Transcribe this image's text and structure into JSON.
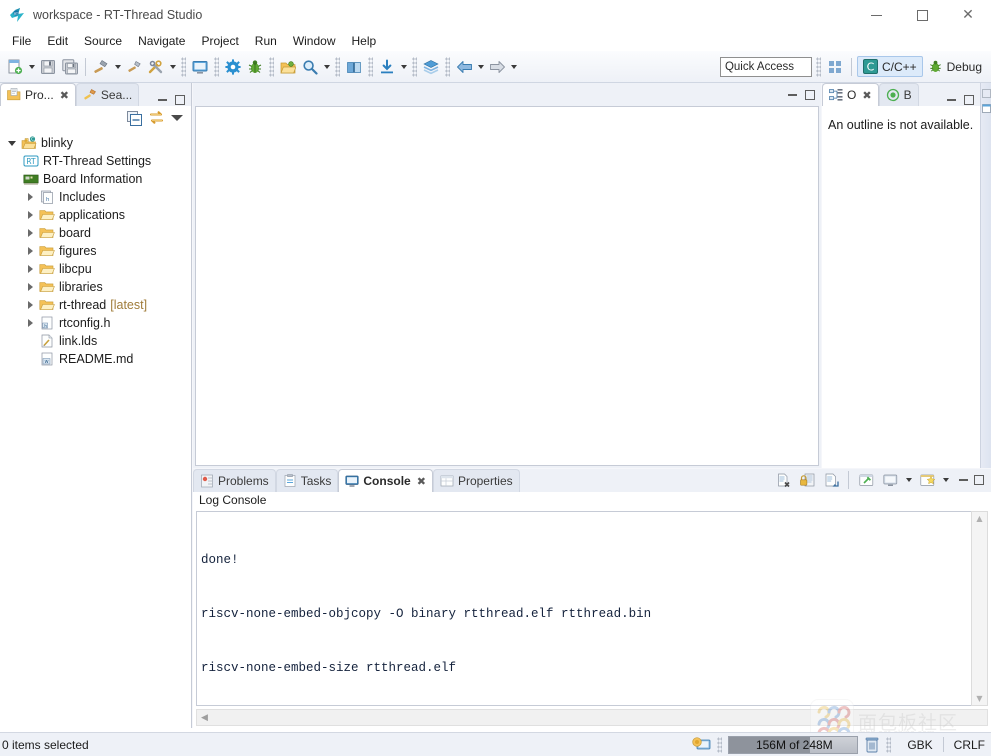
{
  "window": {
    "title": "workspace - RT-Thread Studio",
    "app_icon": "rt-thread-logo-icon",
    "controls": {
      "minimize": "minimize-icon",
      "maximize": "maximize-icon",
      "close": "close-icon"
    }
  },
  "menubar": {
    "items": [
      {
        "label": "File"
      },
      {
        "label": "Edit"
      },
      {
        "label": "Source"
      },
      {
        "label": "Navigate"
      },
      {
        "label": "Project"
      },
      {
        "label": "Run"
      },
      {
        "label": "Window"
      },
      {
        "label": "Help"
      }
    ]
  },
  "toolbar": {
    "items": [
      {
        "icon": "new-file-icon",
        "dropdown": true
      },
      {
        "icon": "save-icon",
        "dropdown": false
      },
      {
        "icon": "save-all-icon",
        "dropdown": false
      },
      {
        "icon": "build-hammer-icon",
        "dropdown": true
      },
      {
        "icon": "clean-icon",
        "dropdown": false
      },
      {
        "icon": "build-tools-icon",
        "dropdown": true
      },
      {
        "icon": "terminal-icon",
        "dropdown": false
      },
      {
        "icon": "settings-gear-icon",
        "dropdown": false
      },
      {
        "icon": "debug-bug-icon",
        "dropdown": false
      },
      {
        "icon": "open-package-icon",
        "dropdown": false
      },
      {
        "icon": "search-icon",
        "dropdown": true
      },
      {
        "icon": "book-icon",
        "dropdown": false
      },
      {
        "icon": "download-icon",
        "dropdown": true
      },
      {
        "icon": "layers-icon",
        "dropdown": false
      },
      {
        "icon": "back-arrow-icon",
        "dropdown": true
      },
      {
        "icon": "forward-arrow-icon",
        "dropdown": true
      }
    ],
    "quick_access": "Quick Access",
    "perspectives": {
      "open_perspective_icon": "grid-perspective-icon",
      "items": [
        {
          "label": "C/C++",
          "icon": "cpp-perspective-icon",
          "active": true
        },
        {
          "label": "Debug",
          "icon": "debug-bug-icon",
          "active": false
        }
      ]
    }
  },
  "left_panel": {
    "tabs": [
      {
        "label": "Pro...",
        "icon": "project-explorer-icon",
        "active": true,
        "closable": true
      },
      {
        "label": "Sea...",
        "icon": "search-view-icon",
        "active": false,
        "closable": false
      }
    ],
    "view_tools": [
      {
        "icon": "collapse-all-icon"
      },
      {
        "icon": "link-with-editor-icon"
      },
      {
        "icon": "view-menu-icon"
      }
    ],
    "tree": [
      {
        "label": "blinky",
        "icon": "c-project-icon",
        "indent": 0,
        "twisty": "open",
        "sub": ""
      },
      {
        "label": "RT-Thread Settings",
        "icon": "rt-settings-icon",
        "indent": 1,
        "twisty": "none",
        "sub": ""
      },
      {
        "label": "Board Information",
        "icon": "board-info-icon",
        "indent": 1,
        "twisty": "none",
        "sub": ""
      },
      {
        "label": "Includes",
        "icon": "includes-icon",
        "indent": 1,
        "twisty": "closed",
        "sub": ""
      },
      {
        "label": "applications",
        "icon": "folder-icon",
        "indent": 1,
        "twisty": "closed",
        "sub": ""
      },
      {
        "label": "board",
        "icon": "folder-icon",
        "indent": 1,
        "twisty": "closed",
        "sub": ""
      },
      {
        "label": "figures",
        "icon": "folder-icon",
        "indent": 1,
        "twisty": "closed",
        "sub": ""
      },
      {
        "label": "libcpu",
        "icon": "folder-icon",
        "indent": 1,
        "twisty": "closed",
        "sub": ""
      },
      {
        "label": "libraries",
        "icon": "folder-icon",
        "indent": 1,
        "twisty": "closed",
        "sub": ""
      },
      {
        "label": "rt-thread",
        "icon": "folder-icon",
        "indent": 1,
        "twisty": "closed",
        "sub": "[latest]"
      },
      {
        "label": "rtconfig.h",
        "icon": "header-file-icon",
        "indent": 1,
        "twisty": "closed",
        "sub": ""
      },
      {
        "label": "link.lds",
        "icon": "lds-file-icon",
        "indent": 1,
        "twisty": "none",
        "sub": ""
      },
      {
        "label": "README.md",
        "icon": "markdown-file-icon",
        "indent": 1,
        "twisty": "none",
        "sub": ""
      }
    ]
  },
  "editor": {
    "minimize_icon": "minimize-view-icon",
    "maximize_icon": "maximize-view-icon",
    "content": ""
  },
  "outline": {
    "tabs": [
      {
        "label": "O",
        "icon": "outline-icon",
        "active": true,
        "closable": true
      },
      {
        "label": "B",
        "icon": "breakpoints-icon",
        "active": false,
        "closable": false
      }
    ],
    "message": "An outline is not available."
  },
  "console": {
    "tabs": [
      {
        "label": "Problems",
        "icon": "problems-icon",
        "active": false,
        "closable": false
      },
      {
        "label": "Tasks",
        "icon": "tasks-icon",
        "active": false,
        "closable": false
      },
      {
        "label": "Console",
        "icon": "console-icon",
        "active": true,
        "closable": true
      },
      {
        "label": "Properties",
        "icon": "properties-icon",
        "active": false,
        "closable": false
      }
    ],
    "tools": [
      {
        "icon": "clear-console-icon",
        "dropdown": false
      },
      {
        "icon": "scroll-lock-icon",
        "dropdown": false
      },
      {
        "icon": "show-console-on-output-icon",
        "dropdown": false
      },
      {
        "icon": "pin-console-icon",
        "dropdown": false
      },
      {
        "icon": "display-selected-console-icon",
        "dropdown": true
      },
      {
        "icon": "open-console-icon",
        "dropdown": true
      },
      {
        "icon": "minimize-view-icon",
        "dropdown": false
      },
      {
        "icon": "maximize-view-icon",
        "dropdown": false
      }
    ],
    "title": "Log Console",
    "lines": [
      "done!",
      "riscv-none-embed-objcopy -O binary rtthread.elf rtthread.bin",
      "riscv-none-embed-size rtthread.elf"
    ]
  },
  "statusbar": {
    "selection": "0 items selected",
    "build_icon": "build-status-icon",
    "heap": {
      "text": "156M of 248M",
      "used_mb": 156,
      "total_mb": 248,
      "percent": 63
    },
    "trash_icon": "trash-icon",
    "encoding": "GBK",
    "line_delimiter": "CRLF"
  },
  "watermark": {
    "text": "面包板社区",
    "url": "mbb.eet-china.com",
    "logo_icon": "mbb-logo-icon"
  },
  "colors": {
    "accent": "#0a74c8",
    "toolbar_bg": "#eef1f7",
    "panel_border": "#c6cbd6",
    "console_text": "#14223c",
    "tree_sub": "#a07c3a"
  }
}
